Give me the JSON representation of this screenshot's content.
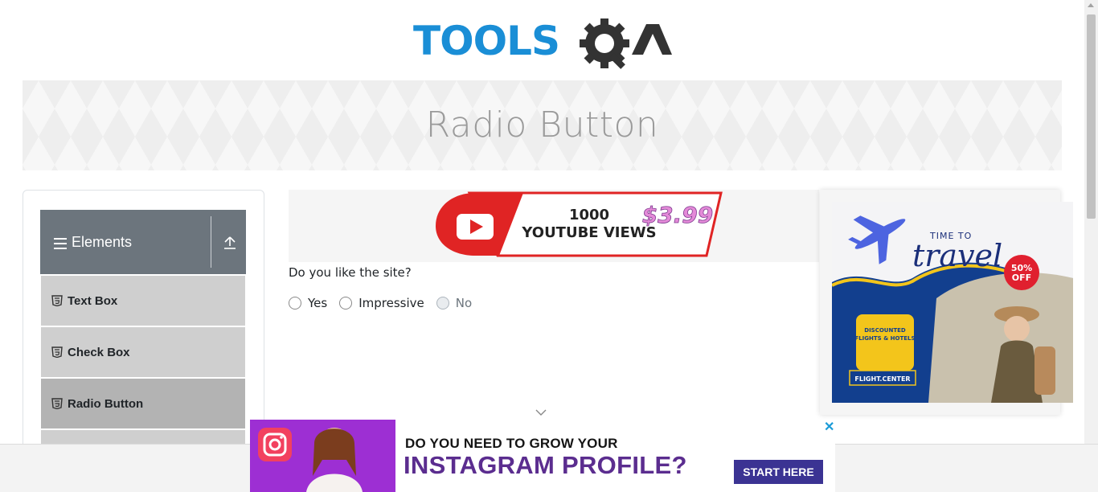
{
  "brand": {
    "logo_text": "TOOLSQA",
    "logo_blue": "#1a8ed6",
    "logo_dark": "#333333"
  },
  "banner": {
    "title": "Radio Button"
  },
  "sidebar": {
    "group_label": "Elements",
    "items": [
      {
        "label": "Text Box",
        "icon": "html5-icon"
      },
      {
        "label": "Check Box",
        "icon": "html5-icon"
      },
      {
        "label": "Radio Button",
        "icon": "html5-icon",
        "active": true
      },
      {
        "label": "",
        "icon": ""
      }
    ]
  },
  "main": {
    "ad_top": {
      "line1": "1000",
      "line2": "YOUTUBE VIEWS",
      "price": "$3.99"
    },
    "question": "Do you like the site?",
    "options": [
      {
        "label": "Yes",
        "disabled": false
      },
      {
        "label": "Impressive",
        "disabled": false
      },
      {
        "label": "No",
        "disabled": true
      }
    ]
  },
  "ad_right": {
    "title_small": "TIME TO",
    "title_big": "travel",
    "badge_line1": "50%",
    "badge_line2": "OFF",
    "box_text_1": "DISCOUNTED",
    "box_text_2": "FLIGHTS & HOTELS",
    "brand": "FLIGHT.CENTER",
    "close": "✕"
  },
  "ad_bottom": {
    "line1": "DO YOU NEED TO GROW YOUR",
    "line2": "INSTAGRAM PROFILE?",
    "cta": "START HERE",
    "close": "✕"
  }
}
